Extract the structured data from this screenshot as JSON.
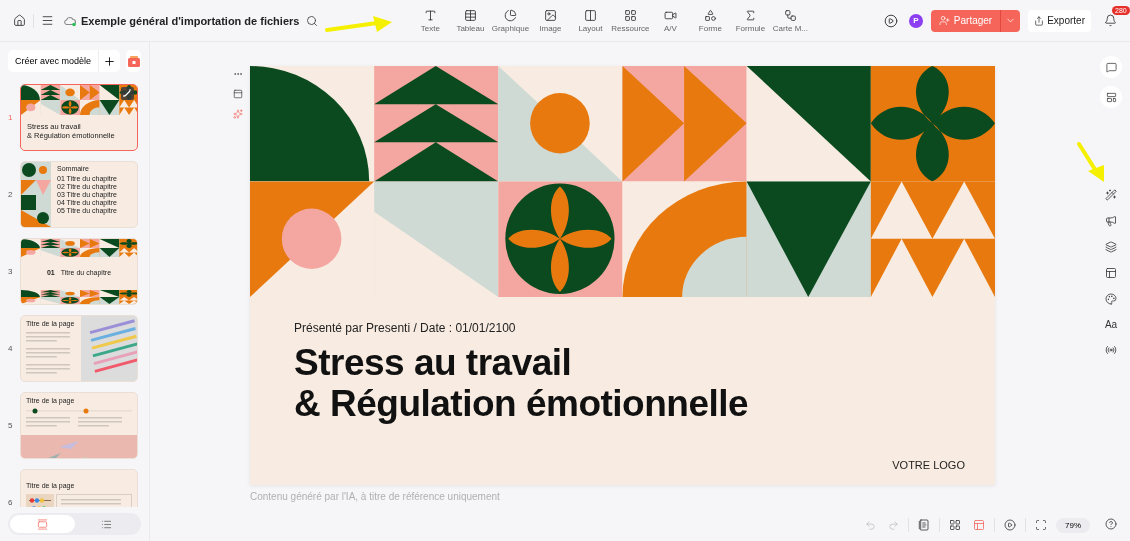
{
  "topbar": {
    "title": "Exemple général d'importation de fichiers",
    "tools": [
      {
        "label": "Texte"
      },
      {
        "label": "Tableau"
      },
      {
        "label": "Graphique"
      },
      {
        "label": "Image"
      },
      {
        "label": "Layout"
      },
      {
        "label": "Ressource"
      },
      {
        "label": "A/V"
      },
      {
        "label": "Forme"
      },
      {
        "label": "Formule"
      },
      {
        "label": "Carte M..."
      }
    ],
    "avatar": "P",
    "share": "Partager",
    "export": "Exporter",
    "notifications": "280"
  },
  "sidebar": {
    "create": "Créer avec modèle",
    "slides": [
      {
        "number": "1",
        "selected": true,
        "kind": "title",
        "title_lines": [
          "Stress au travail",
          "& Régulation émotionnelle"
        ]
      },
      {
        "number": "2",
        "selected": false,
        "kind": "summary",
        "title": "Sommaire",
        "items": [
          "01 Titre du chapitre",
          "02 Titre du chapitre",
          "03 Titre du chapitre",
          "04 Titre du chapitre",
          "05 Titre du chapitre"
        ]
      },
      {
        "number": "3",
        "selected": false,
        "kind": "chapter",
        "index": "01",
        "title": "Titre du chapitre"
      },
      {
        "number": "4",
        "selected": false,
        "title": "Titre de la page"
      },
      {
        "number": "5",
        "selected": false,
        "kind": "timeline",
        "title": "Titre de la page"
      },
      {
        "number": "6",
        "selected": false,
        "kind": "grid",
        "title": "Titre de la page"
      }
    ],
    "views": [
      {
        "selected": true
      },
      {
        "selected": false
      }
    ]
  },
  "slide": {
    "subtitle": "Présenté par Presenti / Date : 01/01/2100",
    "title_lines": [
      "Stress au travail",
      "& Régulation émotionnelle"
    ],
    "logo": "VOTRE LOGO"
  },
  "disclaimer": "Contenu généré par l'IA, à titre de référence uniquement",
  "rail": {
    "font_label": "Aa"
  },
  "zoom": "79%"
}
